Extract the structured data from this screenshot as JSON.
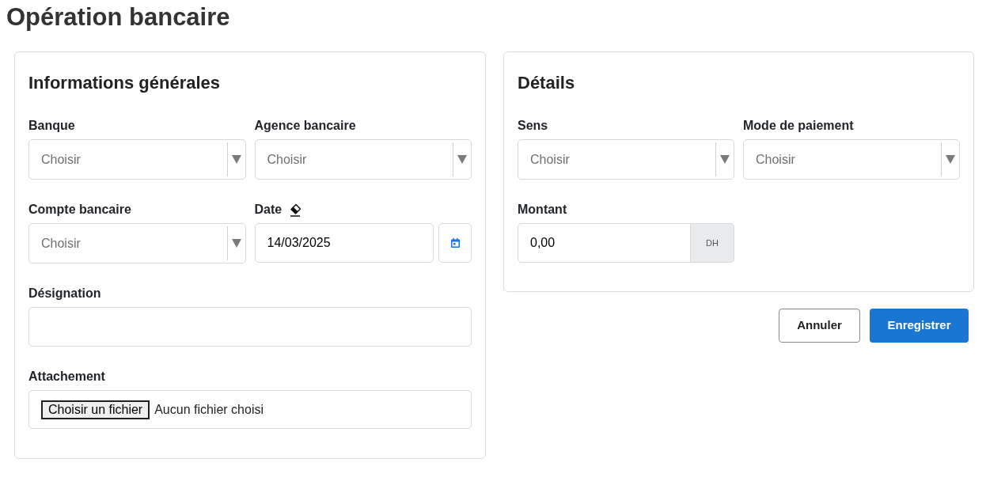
{
  "page": {
    "title": "Opération bancaire"
  },
  "cards": [
    {
      "title": "Informations générales",
      "fields": [
        {
          "kind": "select",
          "label": "Banque",
          "placeholder": "Choisir"
        },
        {
          "kind": "select",
          "label": "Agence bancaire",
          "placeholder": "Choisir"
        },
        {
          "kind": "select",
          "label": "Compte bancaire",
          "placeholder": "Choisir"
        },
        {
          "kind": "date",
          "label": "Date",
          "value": "14/03/2025"
        },
        {
          "kind": "text",
          "label": "Désignation"
        },
        {
          "kind": "file",
          "label": "Attachement",
          "button": "Choisir un fichier",
          "status": "Aucun fichier choisi"
        }
      ]
    },
    {
      "title": "Détails",
      "fields": [
        {
          "kind": "select",
          "label": "Sens",
          "placeholder": "Choisir"
        },
        {
          "kind": "select",
          "label": "Mode de paiement",
          "placeholder": "Choisir"
        },
        {
          "kind": "amount",
          "label": "Montant",
          "value": "0,00",
          "unit": "DH"
        }
      ]
    }
  ],
  "buttons": [
    {
      "kind": "secondary",
      "label": "Annuler"
    },
    {
      "kind": "primary",
      "label": "Enregistrer"
    }
  ]
}
